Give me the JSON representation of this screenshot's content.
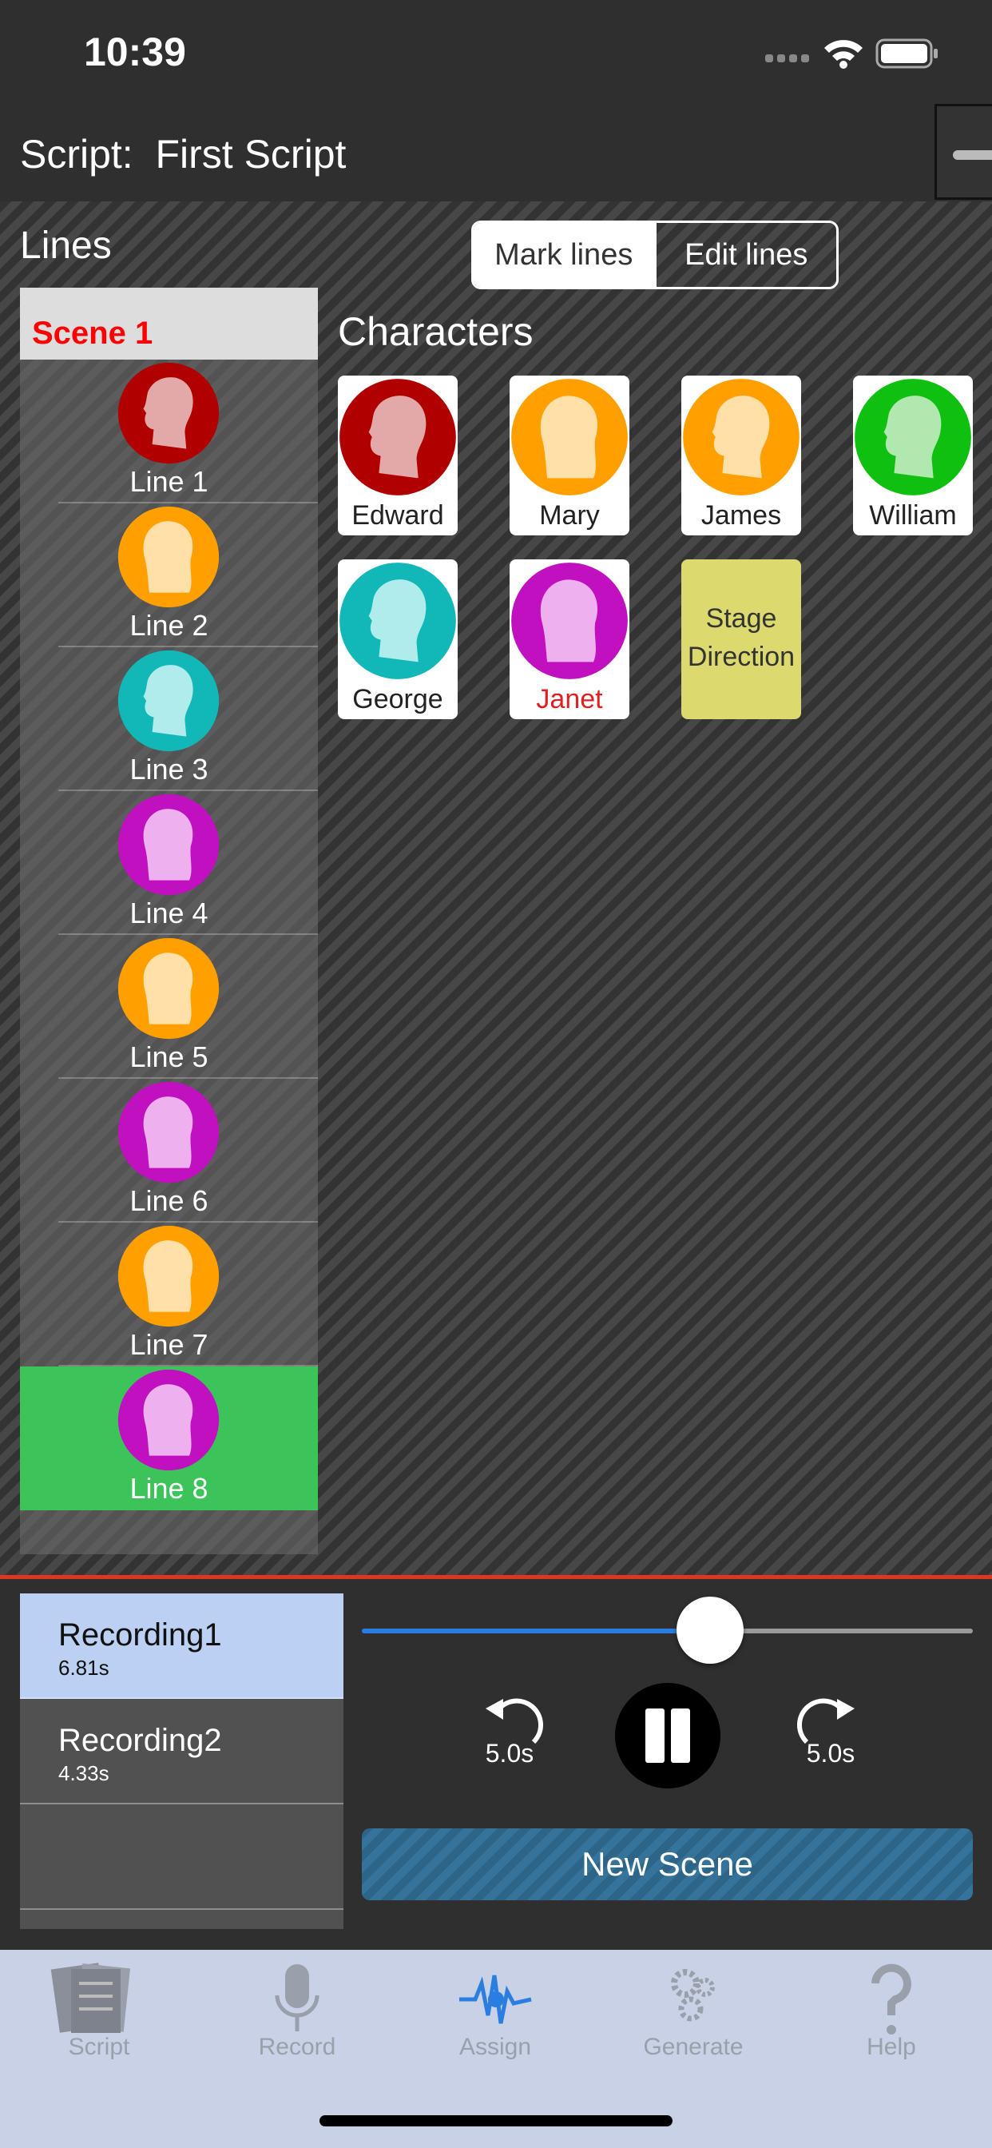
{
  "status_bar": {
    "time": "10:39"
  },
  "nav": {
    "script_label": "Script:",
    "script_name": "First Script"
  },
  "lines_heading": "Lines",
  "segmented": {
    "mark_lines": "Mark lines",
    "edit_lines": "Edit lines"
  },
  "scene": {
    "label": "Scene 1"
  },
  "lines": [
    {
      "label": "Line 1",
      "character": "Edward"
    },
    {
      "label": "Line 2",
      "character": "Mary"
    },
    {
      "label": "Line 3",
      "character": "George"
    },
    {
      "label": "Line 4",
      "character": "Janet"
    },
    {
      "label": "Line 5",
      "character": "Mary"
    },
    {
      "label": "Line 6",
      "character": "Janet"
    },
    {
      "label": "Line 7",
      "character": "Mary"
    },
    {
      "label": "Line 8",
      "character": "Janet"
    }
  ],
  "characters_heading": "Characters",
  "characters": [
    {
      "name": "Edward",
      "ring": "#b00000",
      "face": "#e3a8a8",
      "gender": "male"
    },
    {
      "name": "Mary",
      "ring": "#ffa000",
      "face": "#ffe0a8",
      "gender": "female"
    },
    {
      "name": "James",
      "ring": "#ffa000",
      "face": "#ffe0a8",
      "gender": "male"
    },
    {
      "name": "William",
      "ring": "#10c010",
      "face": "#b0e8b0",
      "gender": "male"
    },
    {
      "name": "George",
      "ring": "#12b8b8",
      "face": "#b0ecec",
      "gender": "male"
    },
    {
      "name": "Janet",
      "ring": "#c010c0",
      "face": "#eeb0ee",
      "gender": "female",
      "name_color": "#e02020"
    }
  ],
  "stage_direction": {
    "line1": "Stage",
    "line2": "Direction"
  },
  "recordings": [
    {
      "name": "Recording1",
      "duration": "6.81s",
      "selected": true
    },
    {
      "name": "Recording2",
      "duration": "4.33s",
      "selected": false
    }
  ],
  "player": {
    "progress": 0.57,
    "rewind_label": "5.0s",
    "forward_label": "5.0s",
    "new_scene_label": "New Scene"
  },
  "tabs": [
    {
      "label": "Script",
      "icon": "script-icon"
    },
    {
      "label": "Record",
      "icon": "microphone-icon"
    },
    {
      "label": "Assign",
      "icon": "waveform-icon",
      "active": true
    },
    {
      "label": "Generate",
      "icon": "gears-icon"
    },
    {
      "label": "Help",
      "icon": "question-icon"
    }
  ]
}
